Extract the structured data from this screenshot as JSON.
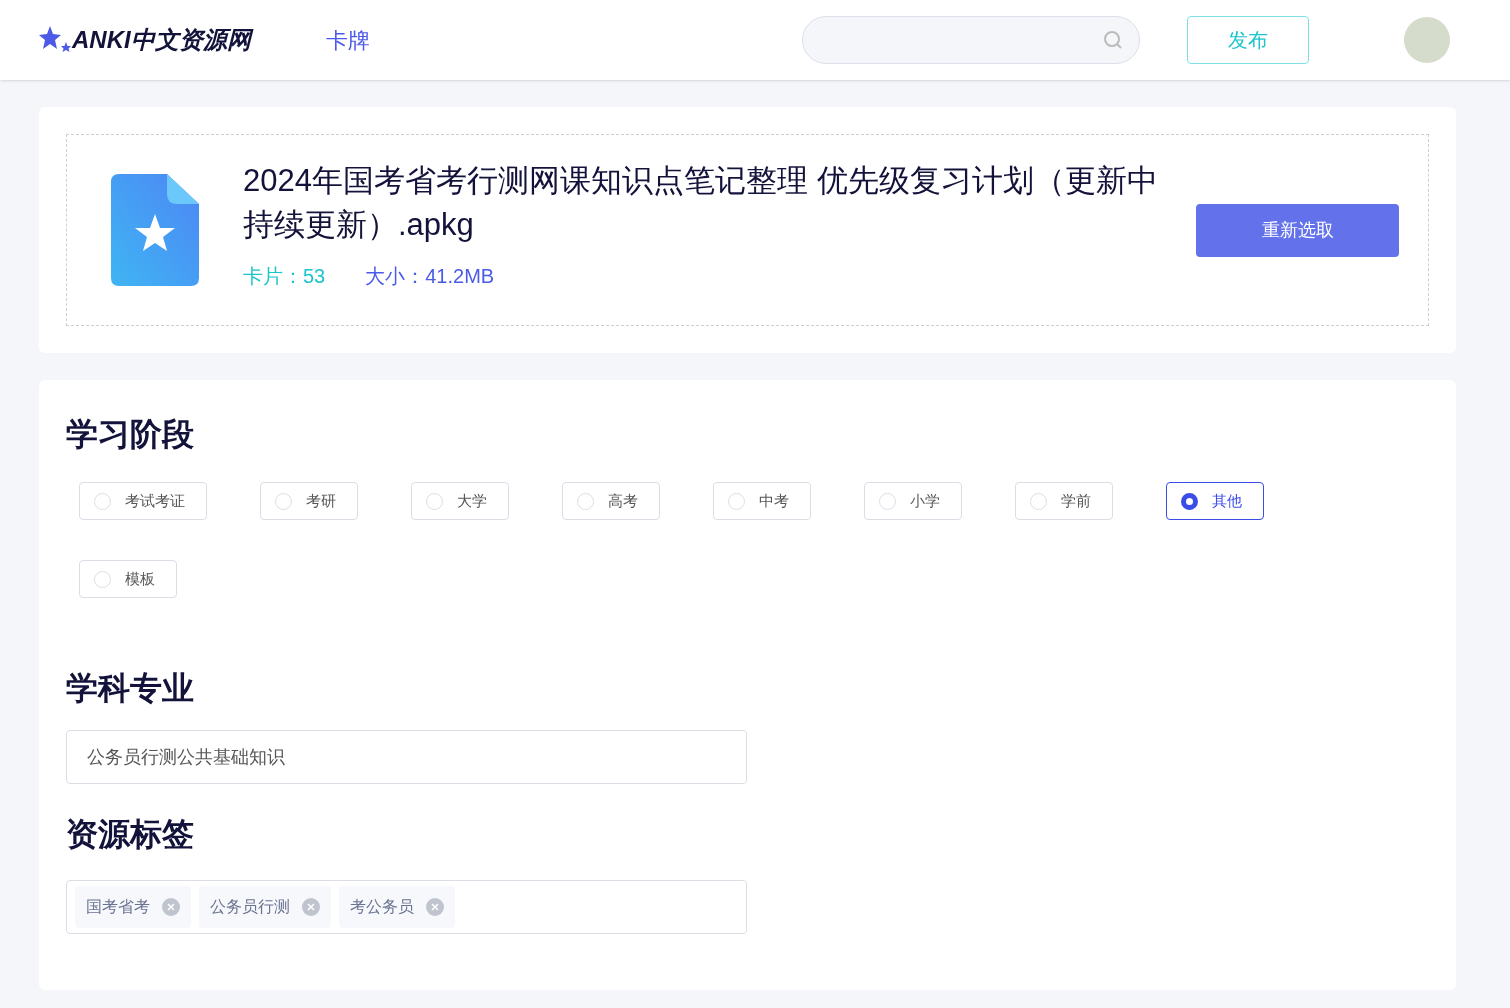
{
  "header": {
    "logo": "ANKI中文资源网",
    "nav": [
      {
        "label": "卡牌",
        "selected": true
      }
    ],
    "publish_button": "发布"
  },
  "file": {
    "name": "2024年国考省考行测网课知识点笔记整理 优先级复习计划（更新中持续更新）.apkg",
    "cards": "卡片：53",
    "size": "大小：41.2MB",
    "reselect_button": "重新选取"
  },
  "stage": {
    "title": "学习阶段",
    "options": [
      {
        "label": "考试考证",
        "selected": false
      },
      {
        "label": "考研",
        "selected": false
      },
      {
        "label": "大学",
        "selected": false
      },
      {
        "label": "高考",
        "selected": false
      },
      {
        "label": "中考",
        "selected": false
      },
      {
        "label": "小学",
        "selected": false
      },
      {
        "label": "学前",
        "selected": false
      },
      {
        "label": "其他",
        "selected": true
      },
      {
        "label": "模板",
        "selected": false
      }
    ]
  },
  "subject": {
    "title": "学科专业",
    "value": "公务员行测公共基础知识"
  },
  "tags": {
    "title": "资源标签",
    "items": [
      "国考省考",
      "公务员行测",
      "考公务员"
    ]
  }
}
